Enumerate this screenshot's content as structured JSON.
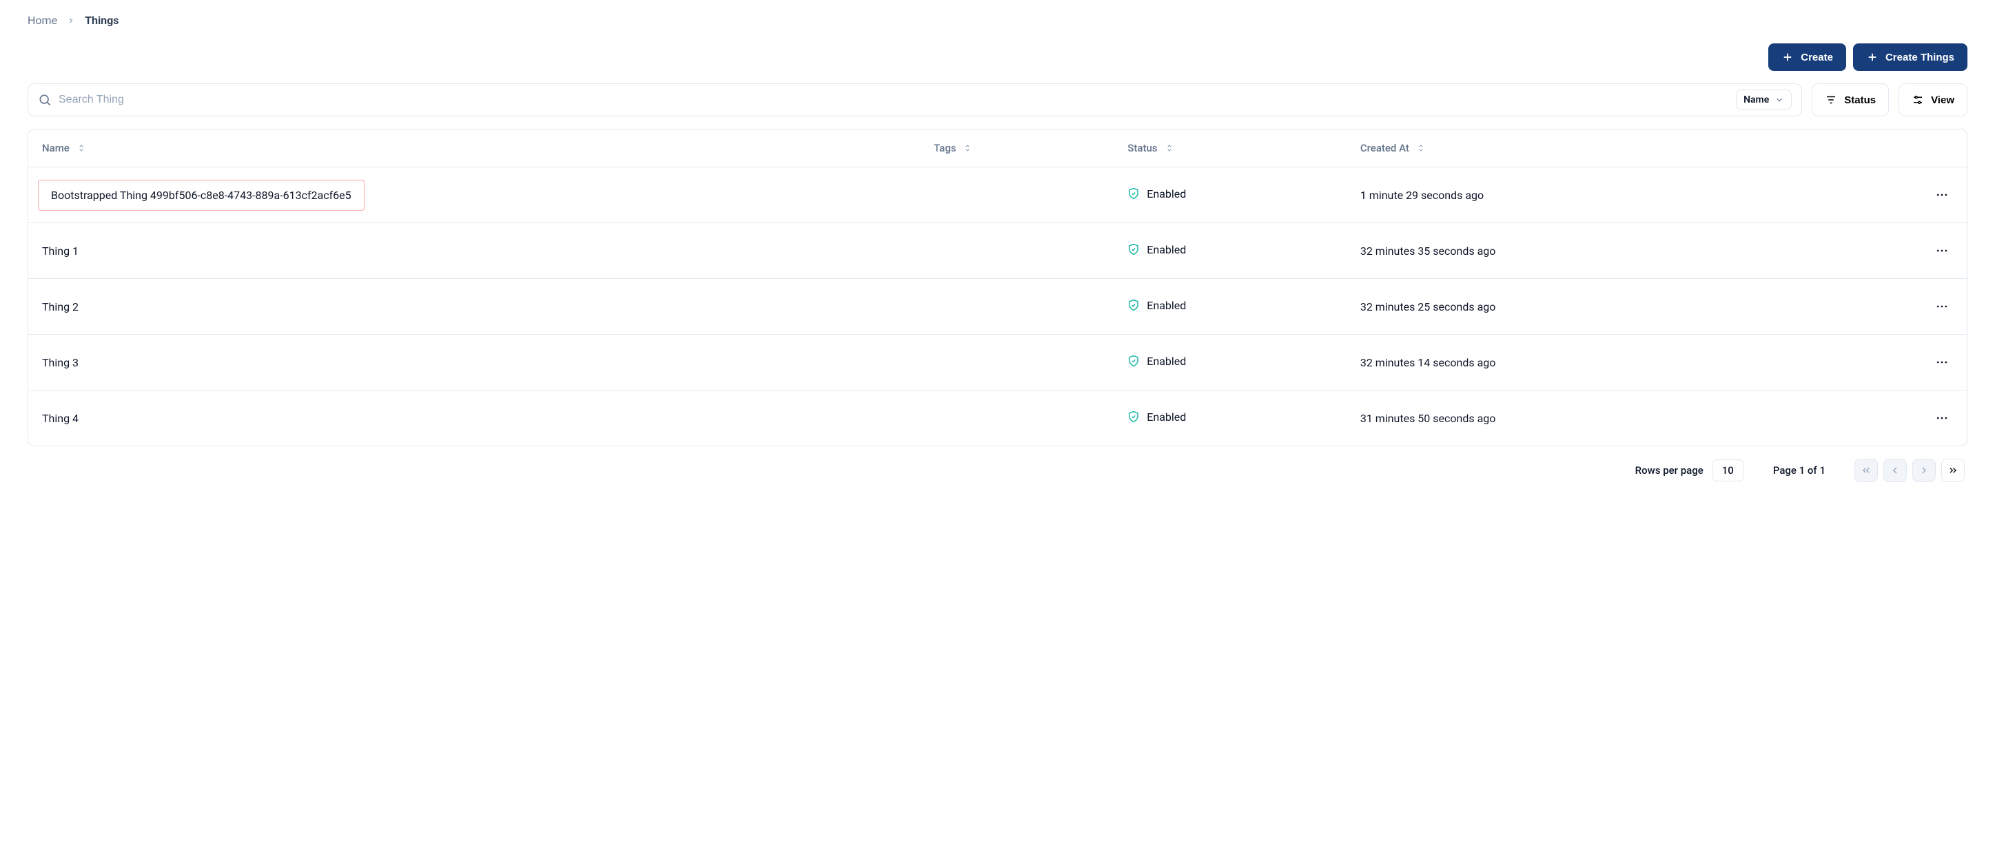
{
  "breadcrumb": {
    "home": "Home",
    "current": "Things"
  },
  "actions": {
    "create": "Create",
    "create_things": "Create Things"
  },
  "search": {
    "placeholder": "Search Thing",
    "filter_label": "Name"
  },
  "toolbar": {
    "status": "Status",
    "view": "View"
  },
  "columns": {
    "name": "Name",
    "tags": "Tags",
    "status": "Status",
    "created_at": "Created At"
  },
  "rows": [
    {
      "name": "Bootstrapped Thing 499bf506-c8e8-4743-889a-613cf2acf6e5",
      "tags": "",
      "status": "Enabled",
      "created_at": "1 minute 29 seconds ago",
      "highlighted": true
    },
    {
      "name": "Thing 1",
      "tags": "",
      "status": "Enabled",
      "created_at": "32 minutes 35 seconds ago",
      "highlighted": false
    },
    {
      "name": "Thing 2",
      "tags": "",
      "status": "Enabled",
      "created_at": "32 minutes 25 seconds ago",
      "highlighted": false
    },
    {
      "name": "Thing 3",
      "tags": "",
      "status": "Enabled",
      "created_at": "32 minutes 14 seconds ago",
      "highlighted": false
    },
    {
      "name": "Thing 4",
      "tags": "",
      "status": "Enabled",
      "created_at": "31 minutes 50 seconds ago",
      "highlighted": false
    }
  ],
  "pagination": {
    "rows_per_page_label": "Rows per page",
    "page_size": "10",
    "page_label": "Page 1 of 1"
  }
}
